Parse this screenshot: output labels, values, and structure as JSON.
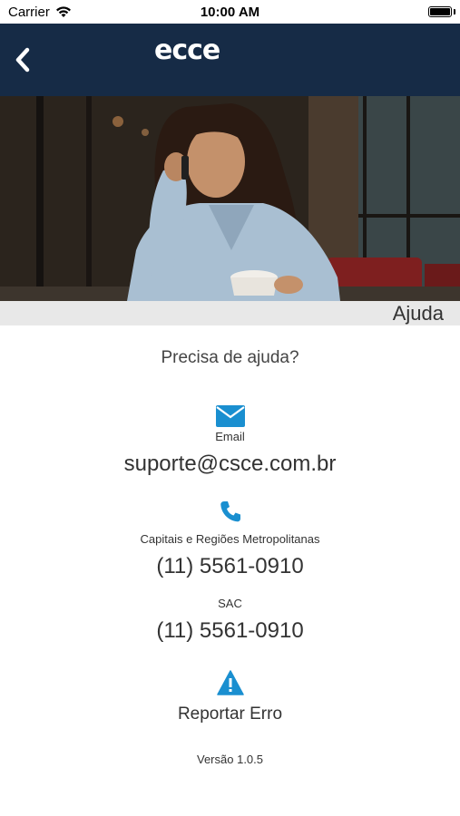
{
  "status_bar": {
    "carrier": "Carrier",
    "time": "10:00 AM"
  },
  "nav": {
    "brand": "ecce"
  },
  "hero": {
    "title": "Ajuda"
  },
  "help": {
    "question": "Precisa de ajuda?",
    "email_label": "Email",
    "email_value": "suporte@csce.com.br",
    "capitals_label": "Capitais e Regiões Metropolitanas",
    "capitals_phone": "(11) 5561-0910",
    "sac_label": "SAC",
    "sac_phone": "(11) 5561-0910",
    "report_label": "Reportar Erro",
    "version": "Versão 1.0.5"
  },
  "colors": {
    "nav_bg": "#162b46",
    "accent_icon": "#1a8fd0",
    "title_bar_bg": "#e8e8e8"
  },
  "icons": [
    "wifi-icon",
    "battery-icon",
    "back-arrow-icon",
    "email-icon",
    "phone-icon",
    "warning-icon"
  ]
}
